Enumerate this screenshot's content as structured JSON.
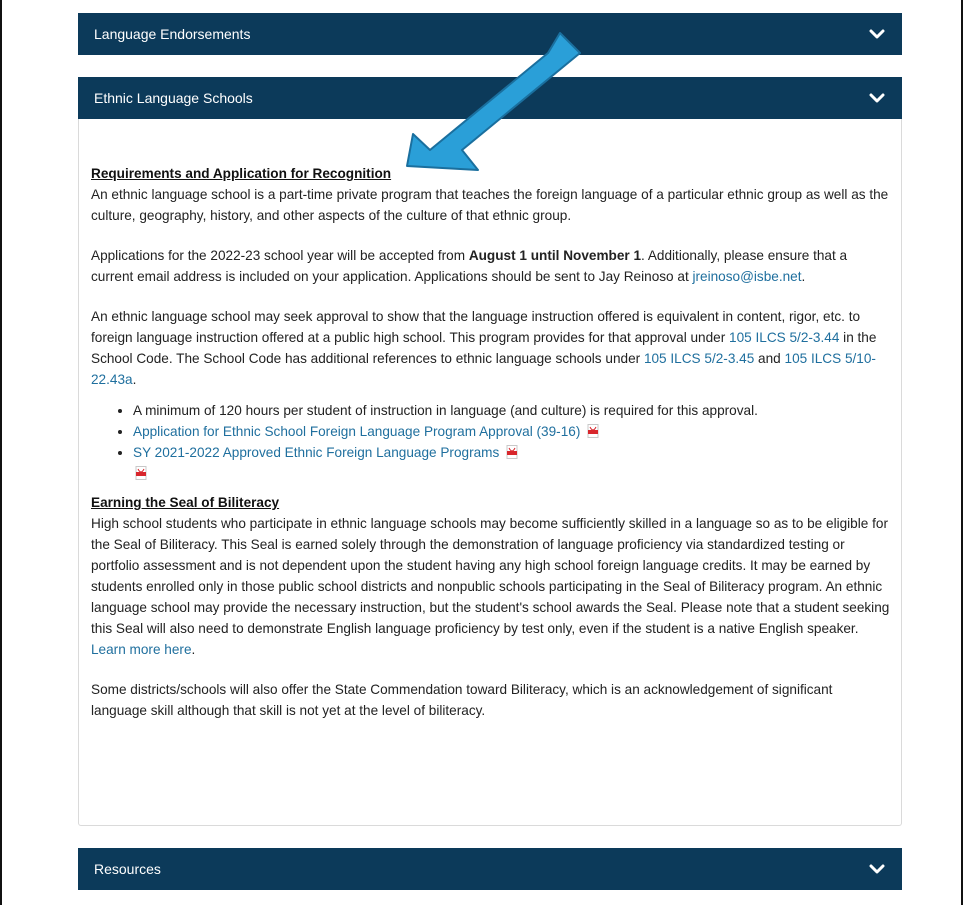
{
  "accordion": {
    "endorsements_title": "Language Endorsements",
    "ethnic_title": "Ethnic Language Schools",
    "resources_title": "Resources"
  },
  "section1": {
    "heading": "Requirements and Application for Recognition",
    "intro": "An ethnic language school is a part-time private program that teaches the foreign language of a particular ethnic group as well as the culture, geography, history, and other aspects of the culture of that ethnic group.",
    "apps_before": "Applications for the 2022-23 school year will be accepted from ",
    "apps_bold": "August 1 until November 1",
    "apps_after": ". Additionally, please ensure that a current email address is included on your application. Applications should be sent to Jay Reinoso at ",
    "email": "jreinoso@isbe.net",
    "apps_end": ".",
    "approval_1": "An ethnic language school may seek approval to show that the language instruction offered is equivalent in content, rigor, etc. to foreign language instruction offered at a public high school. This program provides for that approval under ",
    "link_a": "105 ILCS 5/2-3.44",
    "approval_2": " in the School Code. The School Code has additional references to ethnic language schools under ",
    "link_b": "105 ILCS 5/2-3.45",
    "approval_3": " and ",
    "link_c": "105 ILCS 5/10-22.43a",
    "approval_4": ".",
    "bullet_1": "A minimum of 120 hours per student of instruction in language (and culture) is required for this approval.",
    "bullet_2": "Application for Ethnic School Foreign Language Program Approval (39-16)",
    "bullet_3": "SY 2021-2022 Approved Ethnic Foreign Language Programs"
  },
  "section2": {
    "heading": "Earning the Seal of Biliteracy",
    "body": "High school students who participate in ethnic language schools may become sufficiently skilled in a language so as to be eligible for the Seal of Biliteracy. This Seal is earned solely through the demonstration of language proficiency via standardized testing or portfolio assessment and is not dependent upon the student having any high school foreign language credits. It may be earned by students enrolled only in those public school districts and nonpublic schools participating in the Seal of Biliteracy program. An ethnic language school may provide the necessary instruction, but the student's school awards the Seal. Please note that a student seeking this Seal will also need to demonstrate English language proficiency by test only, even if the student is a native English speaker. ",
    "learn_more": "Learn more here",
    "body_end": ".",
    "commendation": "Some districts/schools will also offer the State Commendation toward Biliteracy, which is an acknowledgement of significant language skill although that skill is not yet at the level of biliteracy."
  },
  "icons": {
    "chevron": "chevron-down-icon",
    "pdf": "pdf-icon",
    "arrow": "annotation-arrow-icon"
  },
  "colors": {
    "header_bg": "#0c3a5a",
    "link": "#1f6f9e",
    "arrow": "#2a9fd8"
  }
}
